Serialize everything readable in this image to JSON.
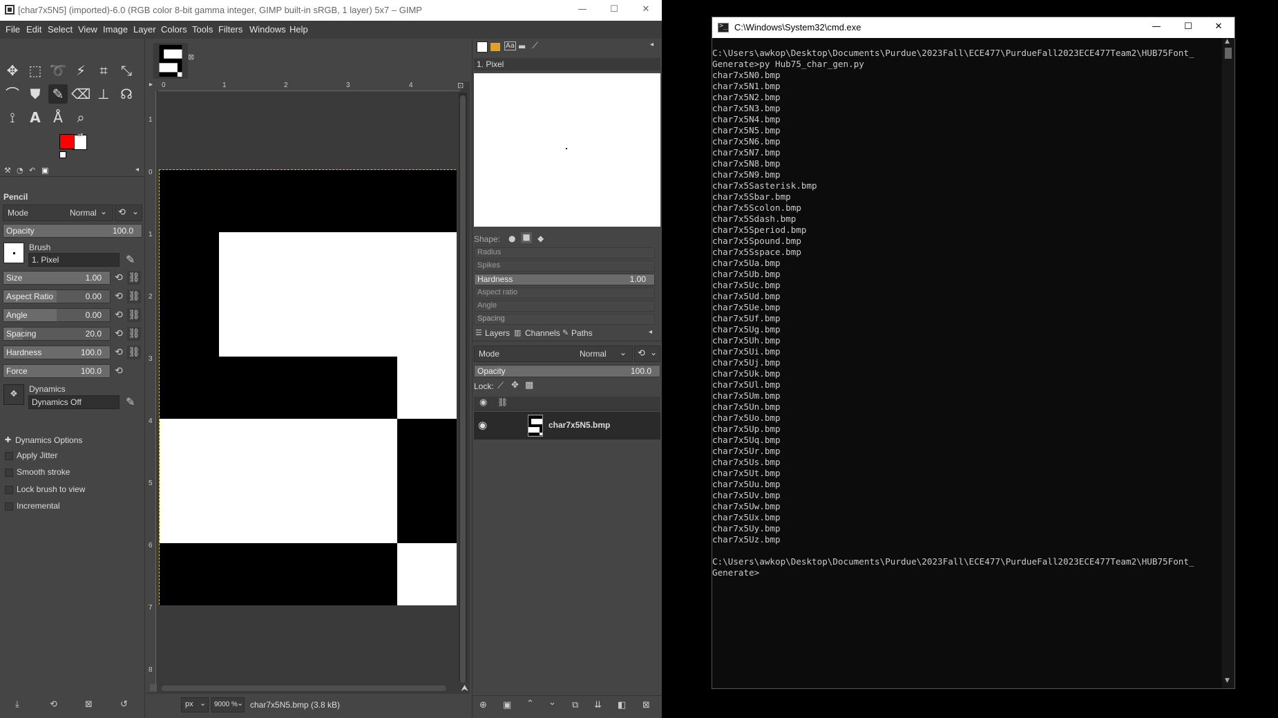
{
  "gimp": {
    "title": "[char7x5N5] (imported)-6.0 (RGB color 8-bit gamma integer, GIMP built-in sRGB, 1 layer) 5x7 – GIMP",
    "menu": [
      "File",
      "Edit",
      "Select",
      "View",
      "Image",
      "Layer",
      "Colors",
      "Tools",
      "Filters",
      "Windows",
      "Help"
    ],
    "tool_options": {
      "tool_name": "Pencil",
      "mode_label": "Mode",
      "mode_value": "Normal",
      "opacity_label": "Opacity",
      "opacity_value": "100.0",
      "brush_label": "Brush",
      "brush_value": "1. Pixel",
      "size_label": "Size",
      "size_value": "1.00",
      "aspect_label": "Aspect Ratio",
      "aspect_value": "0.00",
      "angle_label": "Angle",
      "angle_value": "0.00",
      "spacing_label": "Spacing",
      "spacing_value": "20.0",
      "hardness_label": "Hardness",
      "hardness_value": "100.0",
      "force_label": "Force",
      "force_value": "100.0",
      "dynamics_label": "Dynamics",
      "dynamics_value": "Dynamics Off",
      "dynamics_options": "Dynamics Options",
      "apply_jitter": "Apply Jitter",
      "smooth_stroke": "Smooth stroke",
      "lock_brush": "Lock brush to view",
      "incremental": "Incremental"
    },
    "colors": {
      "foreground": "#ff0000",
      "background": "#ffffff"
    },
    "ruler_h": [
      "0",
      "1",
      "2",
      "3",
      "4"
    ],
    "ruler_v": [
      "0",
      "1",
      "2",
      "3",
      "4",
      "5",
      "6",
      "7",
      "8"
    ],
    "status": {
      "unit": "px",
      "zoom": "9000 %",
      "file": "char7x5N5.bmp (3.8 kB)"
    },
    "brushes": {
      "selected": "1. Pixel",
      "shape_label": "Shape:",
      "radius_label": "Radius",
      "spikes_label": "Spikes",
      "hardness_label": "Hardness",
      "hardness_value": "1.00",
      "aspect_label": "Aspect ratio",
      "angle_label": "Angle",
      "spacing_label": "Spacing"
    },
    "layers": {
      "tabs": [
        "Layers",
        "Channels",
        "Paths"
      ],
      "mode_label": "Mode",
      "mode_value": "Normal",
      "opacity_label": "Opacity",
      "opacity_value": "100.0",
      "lock_label": "Lock:",
      "layer_name": "char7x5N5.bmp"
    },
    "glyph_rows": [
      [
        1,
        1,
        1,
        1,
        1
      ],
      [
        1,
        0,
        0,
        0,
        0
      ],
      [
        1,
        0,
        0,
        0,
        0
      ],
      [
        1,
        1,
        1,
        1,
        0
      ],
      [
        0,
        0,
        0,
        0,
        1
      ],
      [
        0,
        0,
        0,
        0,
        1
      ],
      [
        1,
        1,
        1,
        1,
        0
      ]
    ]
  },
  "cmd": {
    "title": "C:\\Windows\\System32\\cmd.exe",
    "lines": [
      "C:\\Users\\awkop\\Desktop\\Documents\\Purdue\\2023Fall\\ECE477\\PurdueFall2023ECE477Team2\\HUB75Font_",
      "Generate>py Hub75_char_gen.py",
      "char7x5N0.bmp",
      "char7x5N1.bmp",
      "char7x5N2.bmp",
      "char7x5N3.bmp",
      "char7x5N4.bmp",
      "char7x5N5.bmp",
      "char7x5N6.bmp",
      "char7x5N7.bmp",
      "char7x5N8.bmp",
      "char7x5N9.bmp",
      "char7x5Sasterisk.bmp",
      "char7x5Sbar.bmp",
      "char7x5Scolon.bmp",
      "char7x5Sdash.bmp",
      "char7x5Speriod.bmp",
      "char7x5Spound.bmp",
      "char7x5Sspace.bmp",
      "char7x5Ua.bmp",
      "char7x5Ub.bmp",
      "char7x5Uc.bmp",
      "char7x5Ud.bmp",
      "char7x5Ue.bmp",
      "char7x5Uf.bmp",
      "char7x5Ug.bmp",
      "char7x5Uh.bmp",
      "char7x5Ui.bmp",
      "char7x5Uj.bmp",
      "char7x5Uk.bmp",
      "char7x5Ul.bmp",
      "char7x5Um.bmp",
      "char7x5Un.bmp",
      "char7x5Uo.bmp",
      "char7x5Up.bmp",
      "char7x5Uq.bmp",
      "char7x5Ur.bmp",
      "char7x5Us.bmp",
      "char7x5Ut.bmp",
      "char7x5Uu.bmp",
      "char7x5Uv.bmp",
      "char7x5Uw.bmp",
      "char7x5Ux.bmp",
      "char7x5Uy.bmp",
      "char7x5Uz.bmp",
      "",
      "C:\\Users\\awkop\\Desktop\\Documents\\Purdue\\2023Fall\\ECE477\\PurdueFall2023ECE477Team2\\HUB75Font_",
      "Generate>"
    ]
  }
}
